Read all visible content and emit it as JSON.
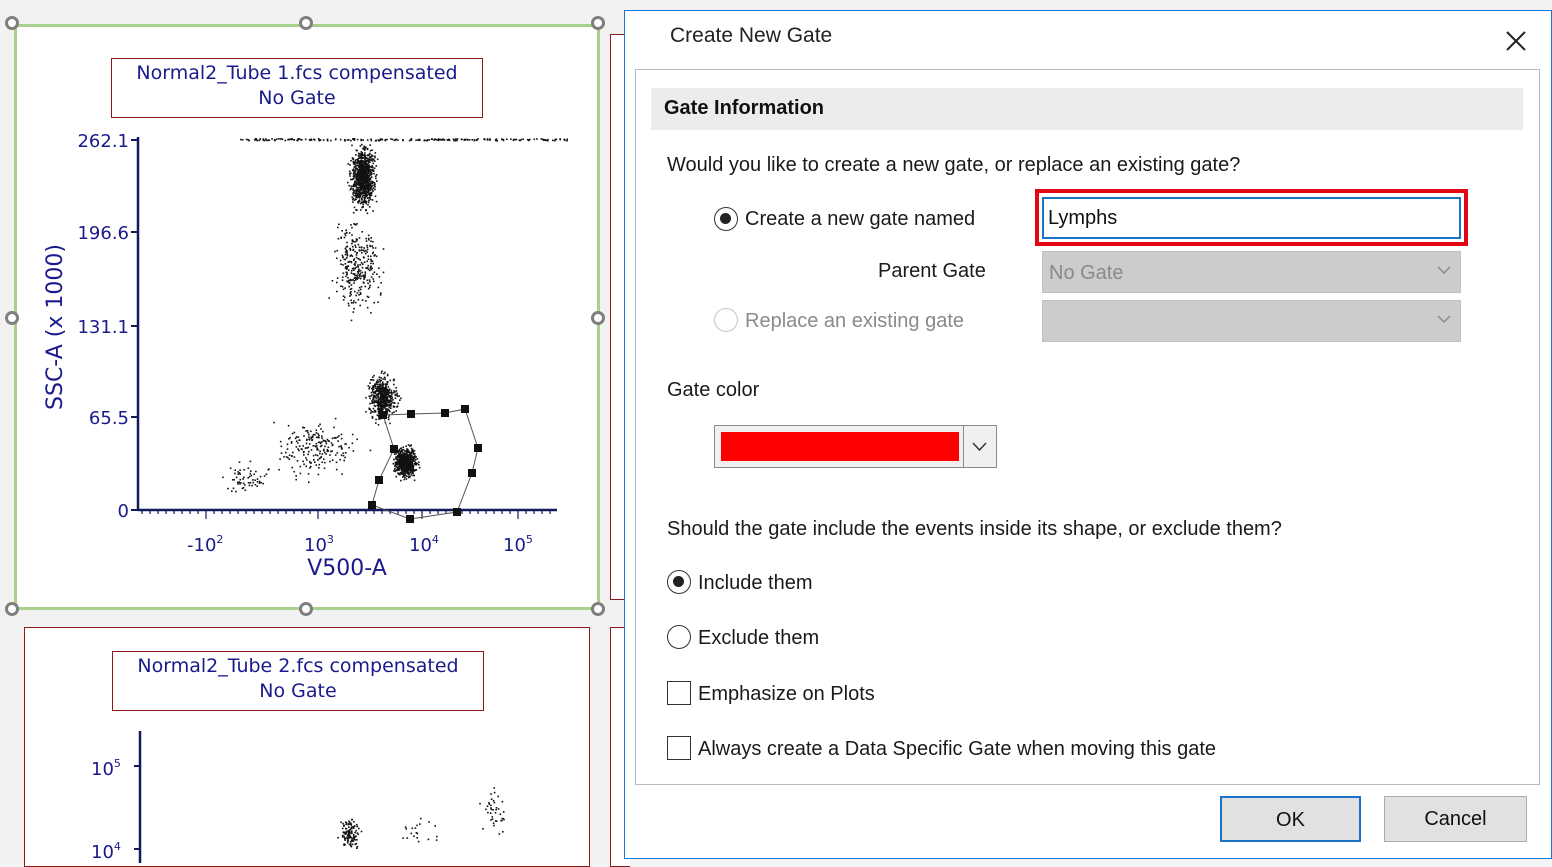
{
  "background": {
    "plot1": {
      "title_line1": "Normal2_Tube 1.fcs compensated",
      "title_line2": "No Gate",
      "y_axis_label": "SSC-A (x 1000)",
      "x_axis_label": "V500-A",
      "y_ticks": [
        "262.1",
        "196.6",
        "131.1",
        "65.5",
        "0"
      ],
      "x_ticks": [
        {
          "base": "-10",
          "exp": "2"
        },
        {
          "base": "10",
          "exp": "3"
        },
        {
          "base": "10",
          "exp": "4"
        },
        {
          "base": "10",
          "exp": "5"
        }
      ]
    },
    "plot2": {
      "title_line1": "Normal2_Tube 2.fcs compensated",
      "title_line2": "No Gate",
      "y_ticks": [
        {
          "base": "10",
          "exp": "5"
        },
        {
          "base": "10",
          "exp": "4"
        }
      ]
    },
    "colors": {
      "title_text": "#1a1a8c",
      "title_border": "#8b1a1a",
      "selection_border": "#a9d18e"
    }
  },
  "dialog": {
    "title": "Create New Gate",
    "close_icon": "close-icon",
    "section_title": "Gate Information",
    "question_create_replace": "Would you like to create a new gate, or replace an existing gate?",
    "create_new_label": "Create a new gate named",
    "gate_name_value": "Lymphs",
    "parent_gate_label": "Parent Gate",
    "parent_gate_value": "No Gate",
    "replace_existing_label": "Replace an existing gate",
    "replace_existing_value": "",
    "gate_color_label": "Gate color",
    "gate_color_value": "#ff0000",
    "question_include_exclude": "Should the gate include the events inside its shape, or exclude them?",
    "include_label": "Include them",
    "exclude_label": "Exclude them",
    "emphasize_label": "Emphasize on Plots",
    "always_create_label": "Always create a Data Specific Gate when moving this gate",
    "ok_label": "OK",
    "cancel_label": "Cancel",
    "create_new_selected": true,
    "include_selected": true,
    "emphasize_checked": false,
    "always_create_checked": false,
    "highlight_color": "#e30613",
    "focus_color": "#1a73c9"
  }
}
